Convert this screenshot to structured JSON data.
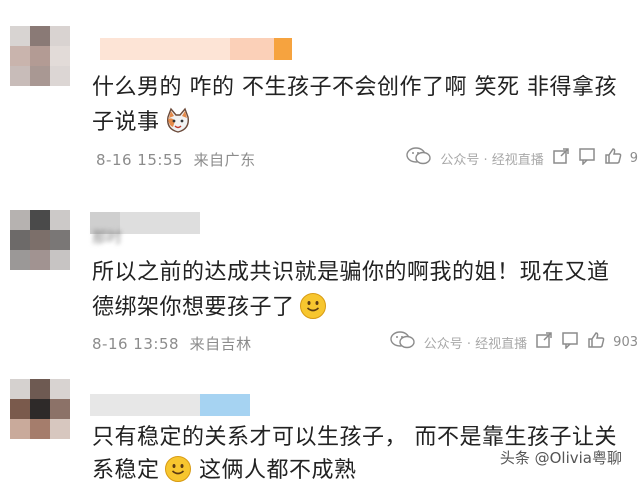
{
  "comments": [
    {
      "name": "",
      "text_line1": "什么男的  咋的  不生孩子不会创作了啊  笑死  非得拿孩",
      "text_line2": "子说事",
      "emoji": "cat-face-icon",
      "date": "8-16 15:55",
      "location": "来自广东",
      "watermark": "公众号 · 经视直播",
      "count": "9"
    },
    {
      "name": "那时",
      "text_line1": "所以之前的达成共识就是骗你的啊我的姐！现在又道",
      "text_line2": "德绑架你想要孩子了",
      "emoji": "smile-face-icon",
      "date": "8-16 13:58",
      "location": "来自吉林",
      "watermark": "公众号 · 经视直播",
      "count": "903"
    },
    {
      "name": "",
      "text_line1": "只有稳定的关系才可以生孩子，  而不是靠生孩子让关",
      "text_line2": "系稳定",
      "text_line2_tail": "这俩人都不成熟",
      "emoji": "smile-face-icon"
    }
  ],
  "bottom_watermark": "头条 @Olivia粤聊",
  "colors": {
    "name_peach": "#fcd9c7",
    "name_orange": "#f6a33f",
    "name_blue": "#a6d3f2",
    "emoji_yellow": "#f7c62f"
  }
}
